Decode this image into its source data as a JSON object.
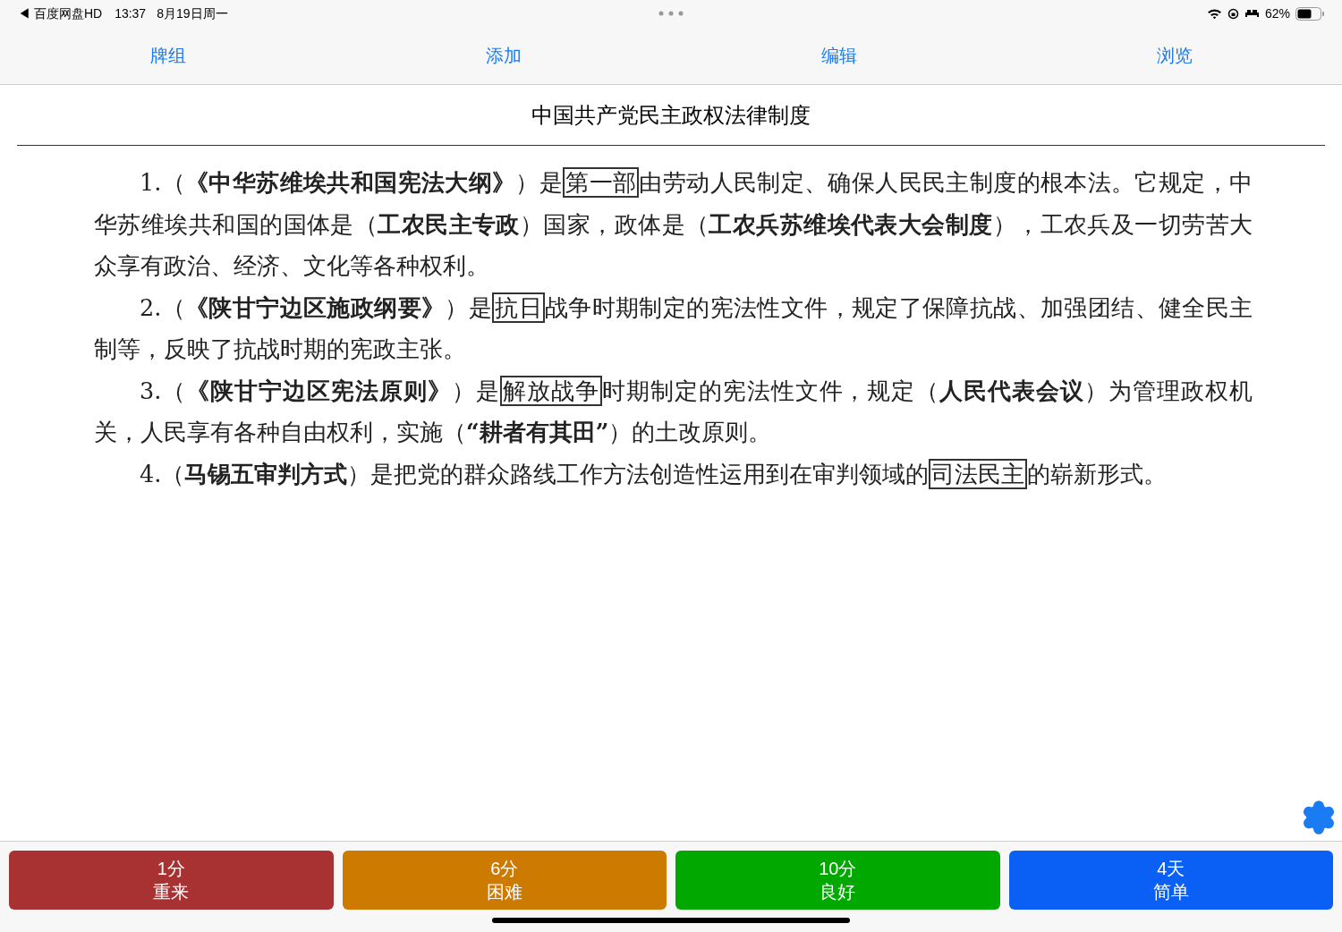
{
  "status_bar": {
    "back_app": "◀ 百度网盘HD",
    "time": "13:37",
    "date": "8月19日周一",
    "battery": "62%"
  },
  "toolbar": [
    {
      "label": "牌组"
    },
    {
      "label": "添加"
    },
    {
      "label": "编辑"
    },
    {
      "label": "浏览"
    }
  ],
  "card": {
    "title": "中国共产党民主政权法律制度",
    "paragraphs": [
      [
        {
          "kind": "plain",
          "text": "1.（"
        },
        {
          "kind": "bold",
          "text": "《中华苏维埃共和国宪法大纲》"
        },
        {
          "kind": "plain",
          "text": "）是"
        },
        {
          "kind": "boxed",
          "text": "第一部"
        },
        {
          "kind": "plain",
          "text": "由劳动人民制定、确保人民民主制度的根本法。它规定，中华苏维埃共和国的国体是（"
        },
        {
          "kind": "bold",
          "text": "工农民主专政"
        },
        {
          "kind": "plain",
          "text": "）国家，政体是（"
        },
        {
          "kind": "bold",
          "text": "工农兵苏维埃代表大会制度"
        },
        {
          "kind": "plain",
          "text": "），工农兵及一切劳苦大众享有政治、经济、文化等各种权利。"
        }
      ],
      [
        {
          "kind": "plain",
          "text": "2.（"
        },
        {
          "kind": "bold",
          "text": "《陕甘宁边区施政纲要》"
        },
        {
          "kind": "plain",
          "text": "）是"
        },
        {
          "kind": "boxed",
          "text": "抗日"
        },
        {
          "kind": "plain",
          "text": "战争时期制定的宪法性文件，规定了保障抗战、加强团结、健全民主制等，反映了抗战时期的宪政主张。"
        }
      ],
      [
        {
          "kind": "plain",
          "text": "3.（"
        },
        {
          "kind": "bold",
          "text": "《陕甘宁边区宪法原则》"
        },
        {
          "kind": "plain",
          "text": "）是"
        },
        {
          "kind": "boxed",
          "text": "解放战争"
        },
        {
          "kind": "plain",
          "text": "时期制定的宪法性文件，规定（"
        },
        {
          "kind": "bold",
          "text": "人民代表会议"
        },
        {
          "kind": "plain",
          "text": "）为管理政权机关，人民享有各种自由权利，实施（"
        },
        {
          "kind": "bold",
          "text": "“耕者有其田”"
        },
        {
          "kind": "plain",
          "text": "）的土改原则。"
        }
      ],
      [
        {
          "kind": "plain",
          "text": "4.（"
        },
        {
          "kind": "bold",
          "text": "马锡五审判方式"
        },
        {
          "kind": "plain",
          "text": "）是把党的群众路线工作方法创造性运用到在审判领域的"
        },
        {
          "kind": "boxed",
          "text": "司法民主"
        },
        {
          "kind": "plain",
          "text": "的崭新形式。"
        }
      ]
    ]
  },
  "answer_buttons": [
    {
      "interval": "1分",
      "label": "重来",
      "color": "#a83232"
    },
    {
      "interval": "6分",
      "label": "困难",
      "color": "#cc7a00"
    },
    {
      "interval": "10分",
      "label": "良好",
      "color": "#00a800"
    },
    {
      "interval": "4天",
      "label": "简单",
      "color": "#0a60f5"
    }
  ]
}
